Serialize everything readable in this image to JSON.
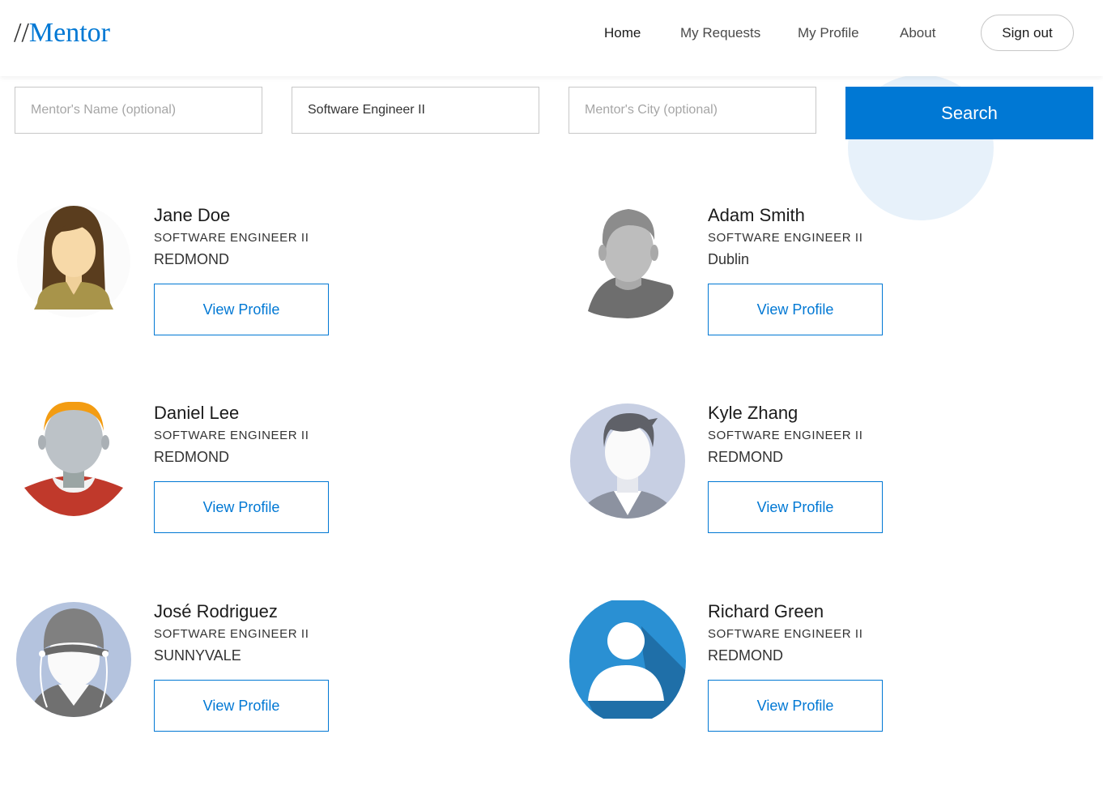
{
  "header": {
    "logo_slashes": "//",
    "logo_brand": "Mentor",
    "nav": [
      {
        "label": "Home",
        "active": true
      },
      {
        "label": "My Requests",
        "active": false
      },
      {
        "label": "My Profile",
        "active": false
      },
      {
        "label": "About",
        "active": false
      }
    ],
    "signout_label": "Sign out"
  },
  "search": {
    "name_placeholder": "Mentor's Name (optional)",
    "name_value": "",
    "role_value": "Software Engineer II",
    "city_placeholder": "Mentor's City (optional)",
    "city_value": "",
    "button_label": "Search"
  },
  "mentors": [
    {
      "name": "Jane Doe",
      "title": "SOFTWARE ENGINEER II",
      "city": "REDMOND",
      "button": "View Profile",
      "avatar": "woman-avatar-icon"
    },
    {
      "name": "Adam Smith",
      "title": "SOFTWARE ENGINEER II",
      "city": "Dublin",
      "button": "View Profile",
      "avatar": "man-silhouette-icon"
    },
    {
      "name": "Daniel Lee",
      "title": "SOFTWARE ENGINEER II",
      "city": "REDMOND",
      "button": "View Profile",
      "avatar": "man-orange-hair-icon"
    },
    {
      "name": "Kyle Zhang",
      "title": "SOFTWARE ENGINEER II",
      "city": "REDMOND",
      "button": "View Profile",
      "avatar": "man-suit-icon"
    },
    {
      "name": "José Rodriguez",
      "title": "SOFTWARE ENGINEER II",
      "city": "SUNNYVALE",
      "button": "View Profile",
      "avatar": "man-cap-earphones-icon"
    },
    {
      "name": "Richard Green",
      "title": "SOFTWARE ENGINEER II",
      "city": "REDMOND",
      "button": "View Profile",
      "avatar": "generic-user-icon"
    }
  ],
  "colors": {
    "accent": "#0078d4",
    "decoration": "#e7f1fa",
    "border": "#c8c8c8"
  }
}
